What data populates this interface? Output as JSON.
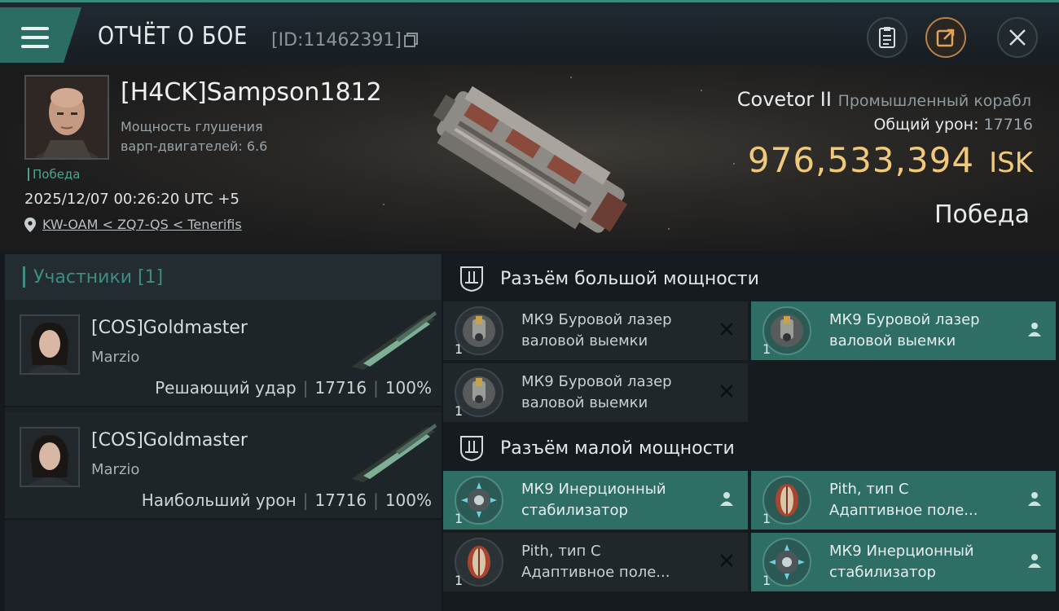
{
  "header": {
    "title": "ОТЧЁТ О БОЕ",
    "report_id": "[ID:11462391]",
    "buttons": [
      "clipboard-icon",
      "share-icon",
      "close-icon"
    ]
  },
  "victim": {
    "name": "[H4CK]Sampson1812",
    "warp_label": "Мощность глушения",
    "warp_value": "варп-двигателей: 6.6",
    "status_tag": "Победа",
    "datetime": "2025/12/07 00:26:20 UTC +5",
    "location": "KW-OAM < ZQ7-QS < Tenerifis"
  },
  "ship": {
    "name": "Covetor II",
    "class": "Промышленный корабл",
    "damage_label": "Общий урон:",
    "damage_value": "17716",
    "isk_value": "976,533,394",
    "isk_unit": "ISK",
    "result": "Победа"
  },
  "participants": {
    "header": "Участники [1]",
    "rows": [
      {
        "name": "[COS]Goldmaster",
        "ship": "Marzio",
        "role": "Решающий удар",
        "damage": "17716",
        "percent": "100%"
      },
      {
        "name": "[COS]Goldmaster",
        "ship": "Marzio",
        "role": "Наибольший урон",
        "damage": "17716",
        "percent": "100%"
      }
    ]
  },
  "modules": {
    "high_title": "Разъём большой мощности",
    "low_title": "Разъём малой мощности",
    "high": [
      {
        "line1": "МК9 Буровой лазер",
        "line2": "валовой выемки",
        "qty": "1",
        "state": "destroyed",
        "icon": "drill-laser-icon"
      },
      {
        "line1": "МК9 Буровой лазер",
        "line2": "валовой выемки",
        "qty": "1",
        "state": "dropped",
        "icon": "drill-laser-icon"
      },
      {
        "line1": "МК9 Буровой лазер",
        "line2": "валовой выемки",
        "qty": "1",
        "state": "destroyed",
        "icon": "drill-laser-icon"
      }
    ],
    "low": [
      {
        "line1": "МК9 Инерционный",
        "line2": "стабилизатор",
        "qty": "1",
        "state": "dropped",
        "icon": "stabilizer-icon"
      },
      {
        "line1": "Pith, тип C",
        "line2": "Адаптивное поле...",
        "qty": "1",
        "state": "dropped",
        "icon": "shield-field-icon"
      },
      {
        "line1": "Pith, тип C",
        "line2": "Адаптивное поле...",
        "qty": "1",
        "state": "destroyed",
        "icon": "shield-field-icon"
      },
      {
        "line1": "МК9 Инерционный",
        "line2": "стабилизатор",
        "qty": "1",
        "state": "dropped",
        "icon": "stabilizer-icon"
      }
    ]
  },
  "colors": {
    "accent_teal": "#2f6e64",
    "isk_gold": "#f1c97a",
    "panel": "#1f272b"
  }
}
